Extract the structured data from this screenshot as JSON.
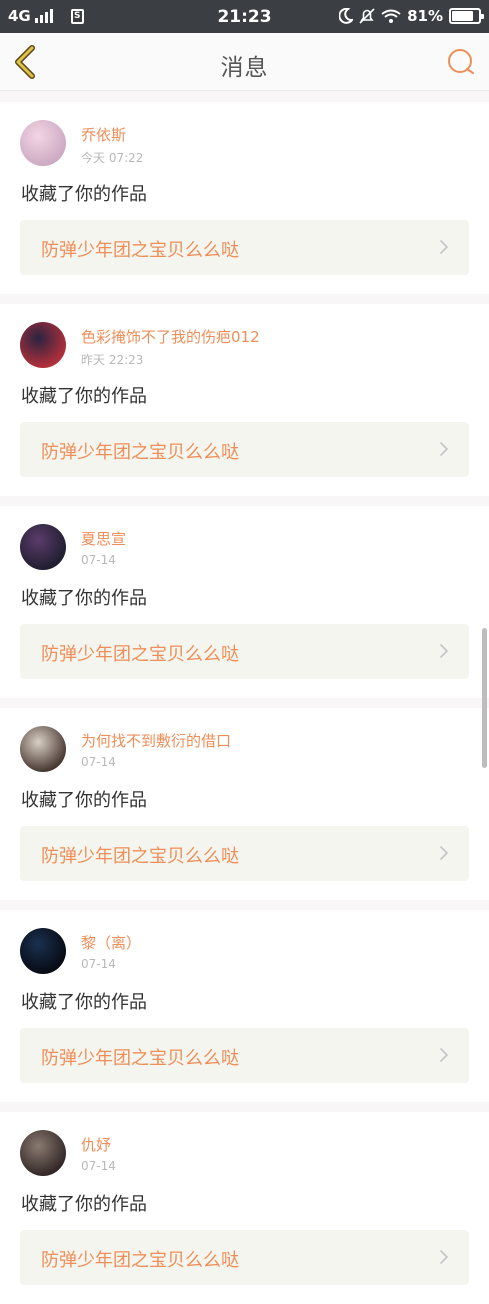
{
  "status_bar": {
    "network": "4G",
    "sim": "S",
    "time": "21:23",
    "battery_percent": "81%",
    "battery_level": 0.81
  },
  "header": {
    "title": "消息",
    "back_icon": "chevron-left-icon",
    "search_icon": "search-icon"
  },
  "colors": {
    "accent": "#ef8e58",
    "back_arrow": "#c9a227"
  },
  "notifications": [
    {
      "user": "乔依斯",
      "time": "今天 07:22",
      "action": "收藏了你的作品",
      "work": "防弹少年团之宝贝么么哒",
      "avatar_colors": [
        "#f3d4e4",
        "#c8a6bf"
      ]
    },
    {
      "user": "色彩掩饰不了我的伤疤012",
      "time": "昨天 22:23",
      "action": "收藏了你的作品",
      "work": "防弹少年团之宝贝么么哒",
      "avatar_colors": [
        "#2a2440",
        "#c0303a"
      ]
    },
    {
      "user": "夏思宣",
      "time": "07-14",
      "action": "收藏了你的作品",
      "work": "防弹少年团之宝贝么么哒",
      "avatar_colors": [
        "#5a3d6a",
        "#1a1a2a"
      ]
    },
    {
      "user": "为何找不到敷衍的借口",
      "time": "07-14",
      "action": "收藏了你的作品",
      "work": "防弹少年团之宝贝么么哒",
      "avatar_colors": [
        "#d9cfc4",
        "#3a2a24"
      ]
    },
    {
      "user": "黎（离）",
      "time": "07-14",
      "action": "收藏了你的作品",
      "work": "防弹少年团之宝贝么么哒",
      "avatar_colors": [
        "#1a3050",
        "#05070d"
      ]
    },
    {
      "user": "仇妤",
      "time": "07-14",
      "action": "收藏了你的作品",
      "work": "防弹少年团之宝贝么么哒",
      "avatar_colors": [
        "#8a7a70",
        "#2a2020"
      ]
    }
  ]
}
